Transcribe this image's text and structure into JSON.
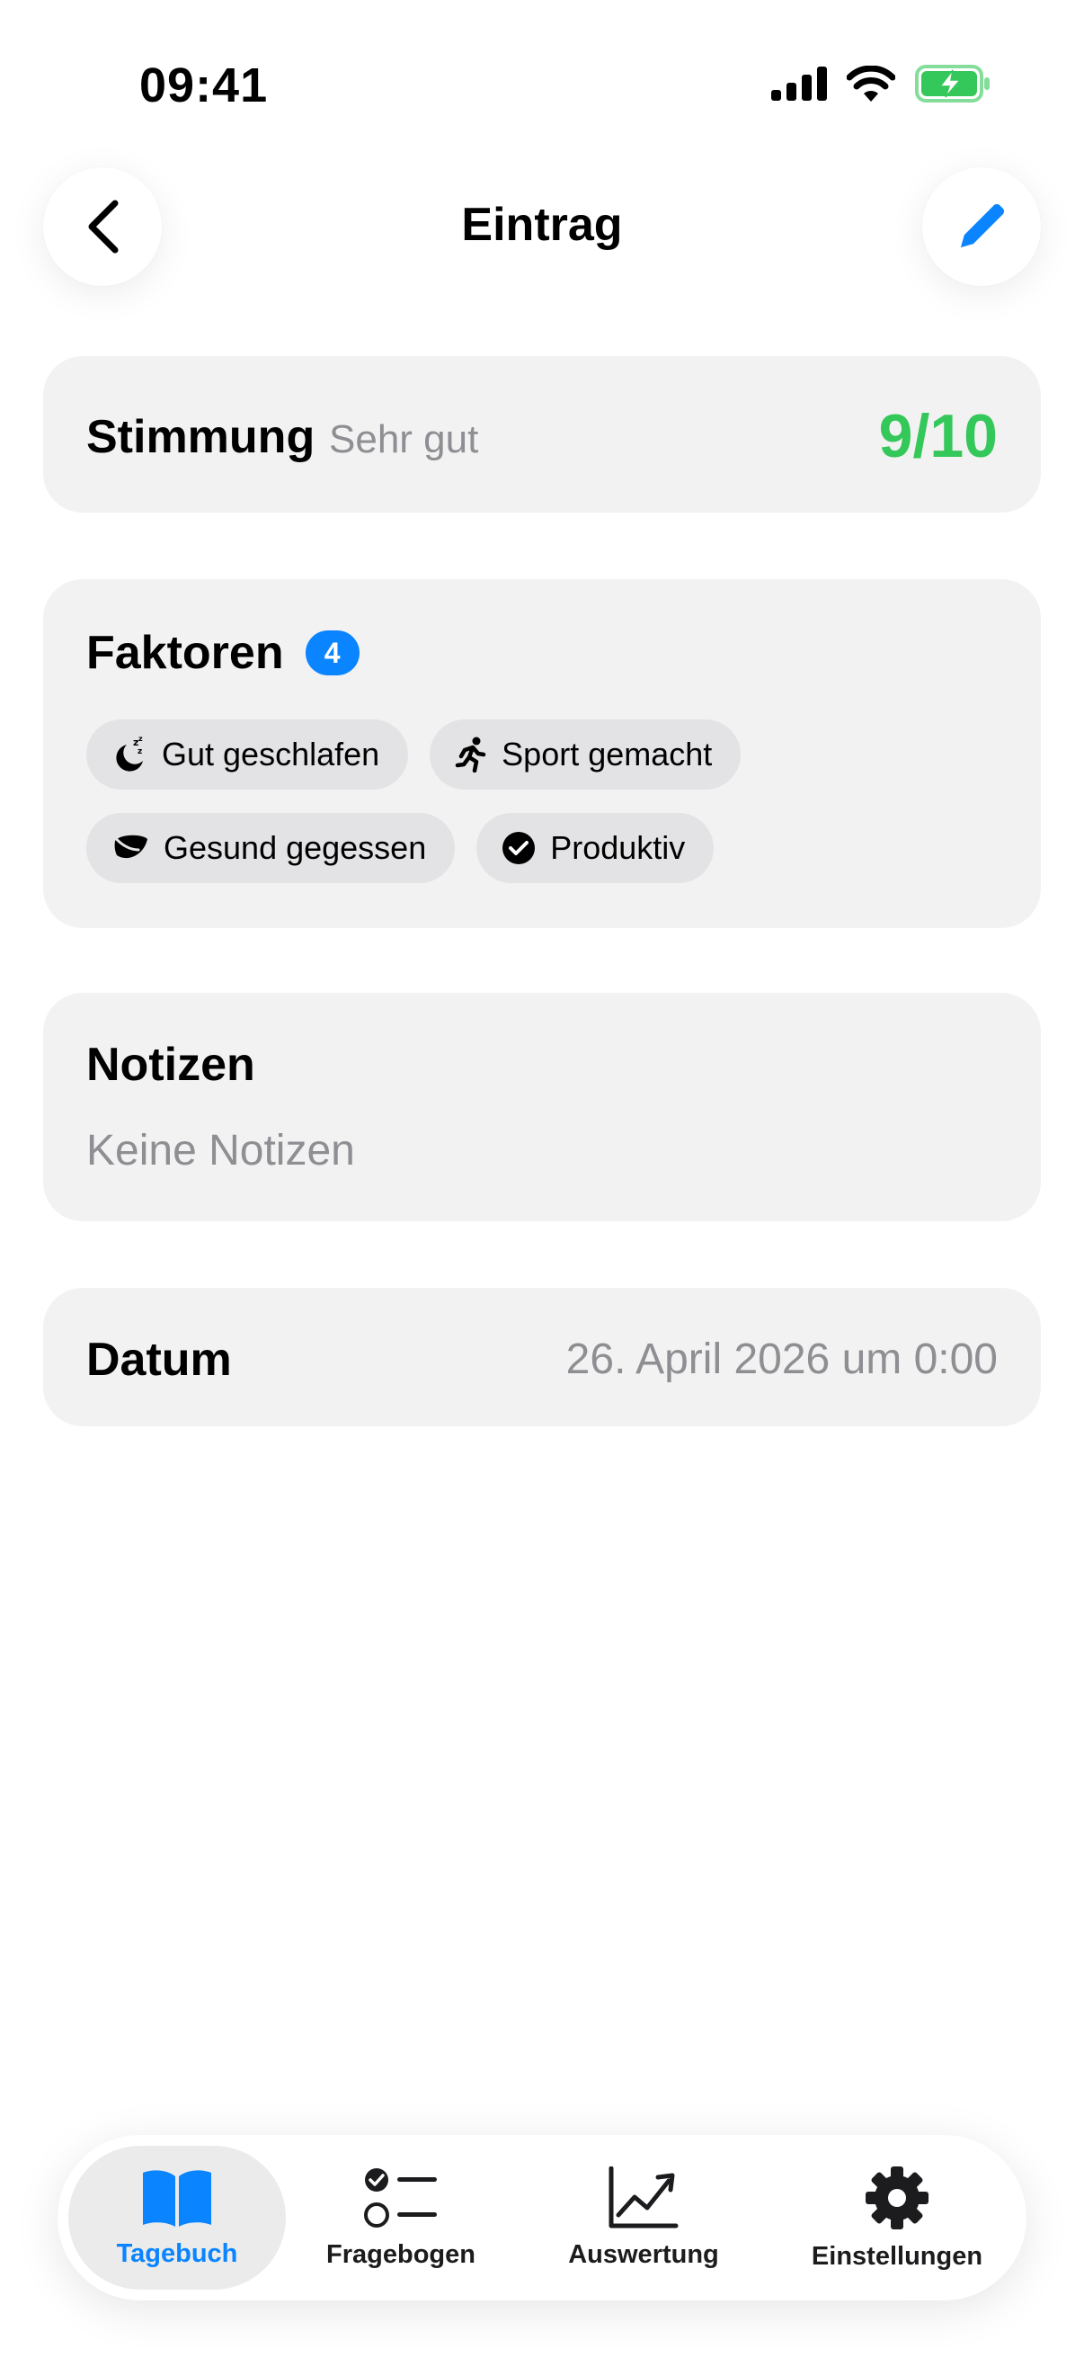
{
  "status": {
    "time": "09:41"
  },
  "nav": {
    "title": "Eintrag"
  },
  "mood": {
    "label": "Stimmung",
    "description": "Sehr gut",
    "score": "9/10",
    "score_color": "#34c759"
  },
  "factors": {
    "label": "Faktoren",
    "count": "4",
    "items": [
      {
        "label": "Gut geschlafen",
        "icon": "moon-zzz-icon"
      },
      {
        "label": "Sport gemacht",
        "icon": "running-icon"
      },
      {
        "label": "Gesund gegessen",
        "icon": "leaf-icon"
      },
      {
        "label": "Produktiv",
        "icon": "checkmark-circle-icon"
      }
    ]
  },
  "notes": {
    "label": "Notizen",
    "text": "Keine Notizen"
  },
  "date": {
    "label": "Datum",
    "value": "26. April 2026 um 0:00"
  },
  "tabs": [
    {
      "label": "Tagebuch",
      "icon": "book-icon",
      "active": true
    },
    {
      "label": "Fragebogen",
      "icon": "checklist-icon",
      "active": false
    },
    {
      "label": "Auswertung",
      "icon": "chart-icon",
      "active": false
    },
    {
      "label": "Einstellungen",
      "icon": "gear-icon",
      "active": false
    }
  ],
  "colors": {
    "accent": "#0a84ff",
    "card": "#f2f2f2",
    "chip": "#e3e3e5"
  }
}
